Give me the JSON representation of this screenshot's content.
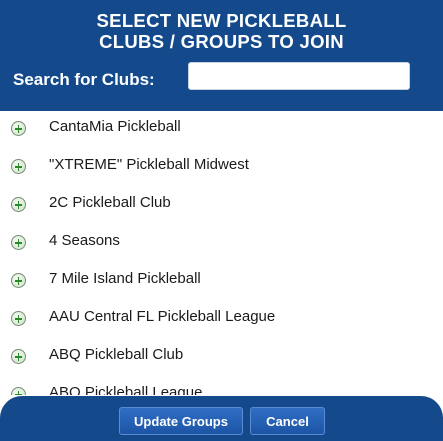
{
  "header": {
    "title_line1": "SELECT NEW PICKLEBALL",
    "title_line2": "CLUBS / GROUPS TO JOIN",
    "search_label": "Search for Clubs:",
    "search_value": "",
    "search_placeholder": ""
  },
  "clubs": [
    {
      "name": "CantaMia Pickleball",
      "icon": "add-circle-icon"
    },
    {
      "name": "\"XTREME\" Pickleball Midwest",
      "icon": "add-circle-icon"
    },
    {
      "name": "2C Pickleball Club",
      "icon": "add-circle-icon"
    },
    {
      "name": "4 Seasons",
      "icon": "add-circle-icon"
    },
    {
      "name": "7 Mile Island Pickleball",
      "icon": "add-circle-icon"
    },
    {
      "name": "AAU Central FL Pickleball League",
      "icon": "add-circle-icon"
    },
    {
      "name": "ABQ Pickleball Club",
      "icon": "add-circle-icon"
    },
    {
      "name": "ABQ Pickleball League",
      "icon": "add-circle-icon"
    }
  ],
  "footer": {
    "update_label": "Update Groups",
    "cancel_label": "Cancel"
  },
  "colors": {
    "header_bg": "#144a8c",
    "button_bg": "#2a66b8",
    "add_icon_green": "#2a8a2a"
  }
}
